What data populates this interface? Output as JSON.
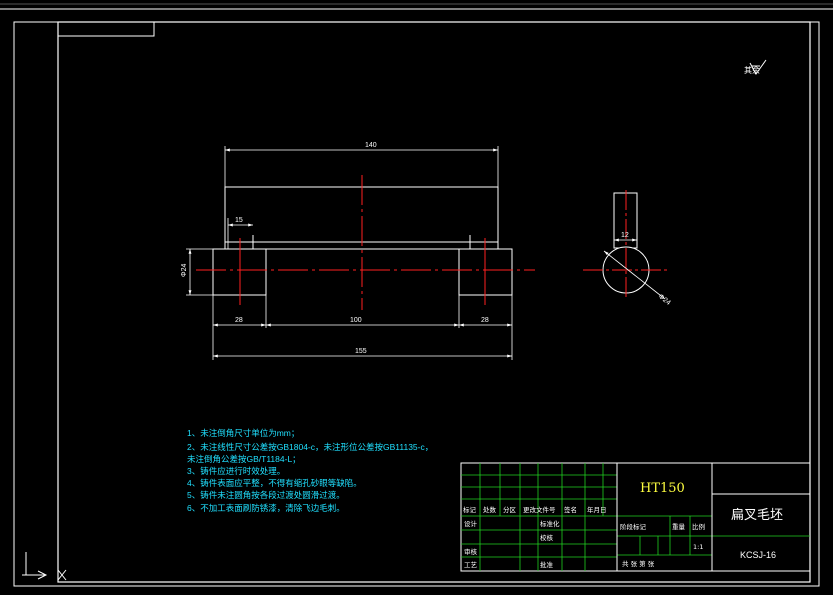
{
  "drawing": {
    "roughness_symbol_text": "其余",
    "dimensions": {
      "total_width_top": "140",
      "left_offset": "15",
      "height_left": "Φ24",
      "left_block": "28",
      "middle_span": "100",
      "right_block": "28",
      "overall": "155",
      "side_width": "12",
      "side_diameter": "Φ24"
    },
    "notes": [
      "1、未注倒角尺寸单位为mm；",
      "2、未注线性尺寸公差按GB1804-c，未注形位公差按GB11135-c，",
      "   未注倒角公差按GB/T1184-L；",
      "3、铸件应进行时效处理。",
      "4、铸件表面应平整，不得有缩孔砂眼等缺陷。",
      "5、铸件未注圆角按各段过渡处圆滑过渡。",
      "6、不加工表面刷防锈漆，清除飞边毛刺。"
    ]
  },
  "title_block": {
    "material": "HT150",
    "part_name": "扁叉毛坯",
    "drawing_number": "KCSJ-16",
    "revision_headers": [
      "标记",
      "处数",
      "分区",
      "更改文件号",
      "签名",
      "年月日"
    ],
    "left_rows": [
      "设计",
      "",
      "审核",
      "工艺"
    ],
    "middle_rows": [
      "标准化",
      "校核",
      "",
      "批准"
    ],
    "stage_headers": [
      "阶段标记",
      "重量",
      "比例"
    ],
    "scale": "1:1",
    "sheet_row": "共   张   第   张"
  }
}
